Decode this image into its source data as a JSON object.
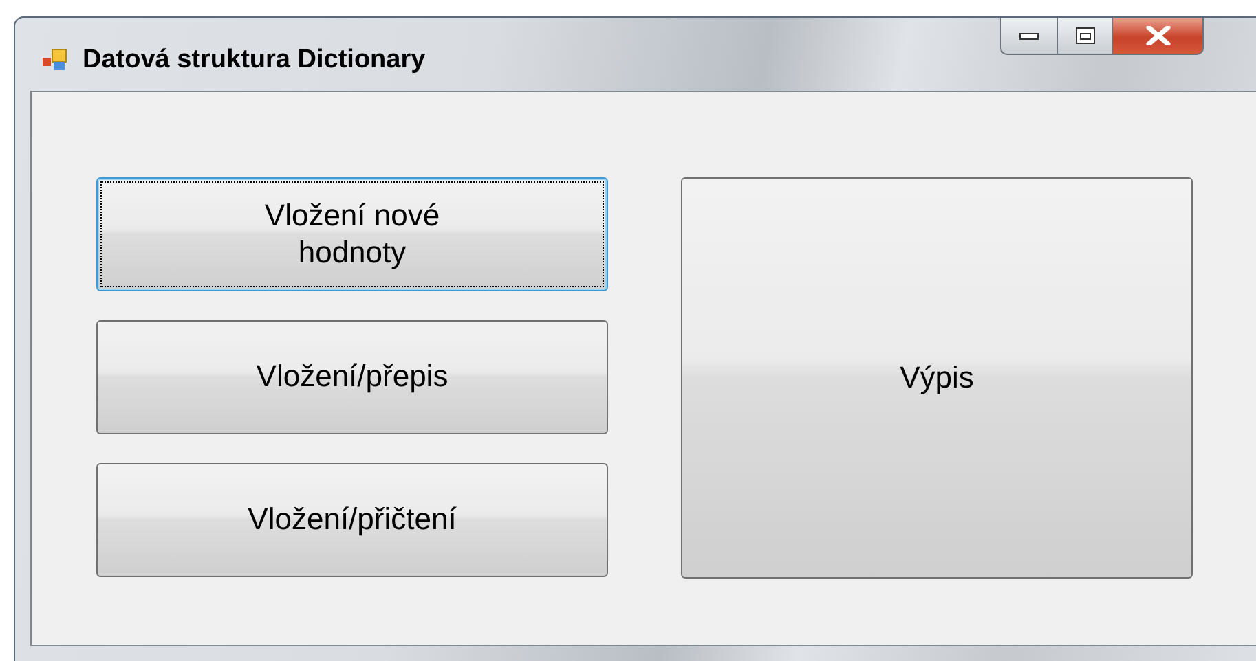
{
  "window": {
    "title": "Datová struktura Dictionary"
  },
  "buttons": [
    {
      "label": "Vložení nové hodnoty",
      "kind": "stacked",
      "focused": true
    },
    {
      "label": "Vložení/přepis",
      "kind": "stacked",
      "focused": false
    },
    {
      "label": "Vložení/přičtení",
      "kind": "stacked",
      "focused": false
    },
    {
      "label": "Výpis",
      "kind": "tall",
      "focused": false
    }
  ]
}
